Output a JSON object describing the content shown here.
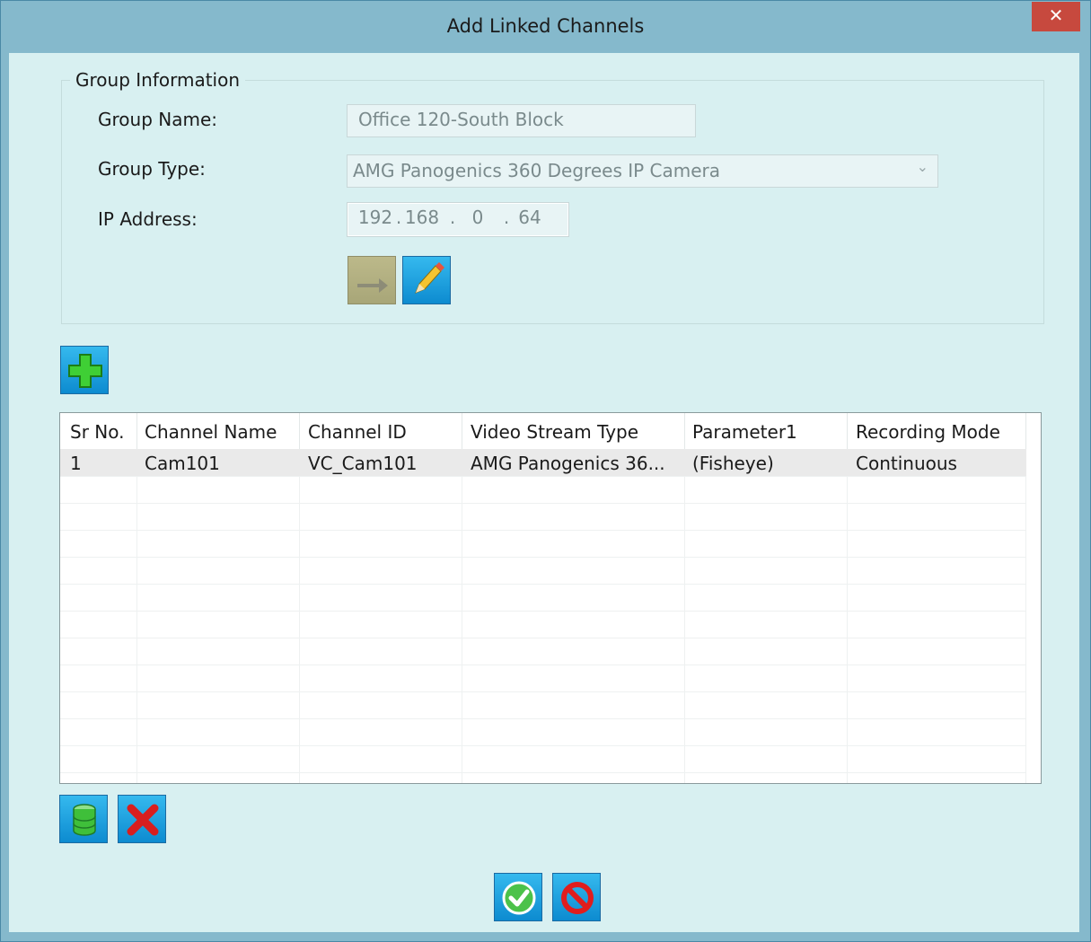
{
  "window": {
    "title": "Add Linked Channels",
    "close_label": "✕"
  },
  "group_info": {
    "legend": "Group Information",
    "group_name_label": "Group Name:",
    "group_name_value": "Office 120-South Block",
    "group_type_label": "Group Type:",
    "group_type_value": "AMG Panogenics 360 Degrees IP Camera",
    "ip_label": "IP Address:",
    "ip": [
      "192",
      "168",
      "0",
      "64"
    ]
  },
  "grid": {
    "columns": [
      "Sr No.",
      "Channel Name",
      "Channel ID",
      "Video Stream Type",
      "Parameter1",
      "Recording Mode"
    ],
    "rows": [
      {
        "sr": "1",
        "name": "Cam101",
        "id": "VC_Cam101",
        "stream": "AMG Panogenics 36...",
        "param": "(Fisheye)",
        "mode": "Continuous"
      }
    ]
  },
  "icons": {
    "apply": "arrow-right-icon",
    "edit": "pencil-icon",
    "add": "plus-icon",
    "database": "database-icon",
    "delete": "red-x-icon",
    "ok": "check-icon",
    "cancel": "prohibited-icon"
  }
}
